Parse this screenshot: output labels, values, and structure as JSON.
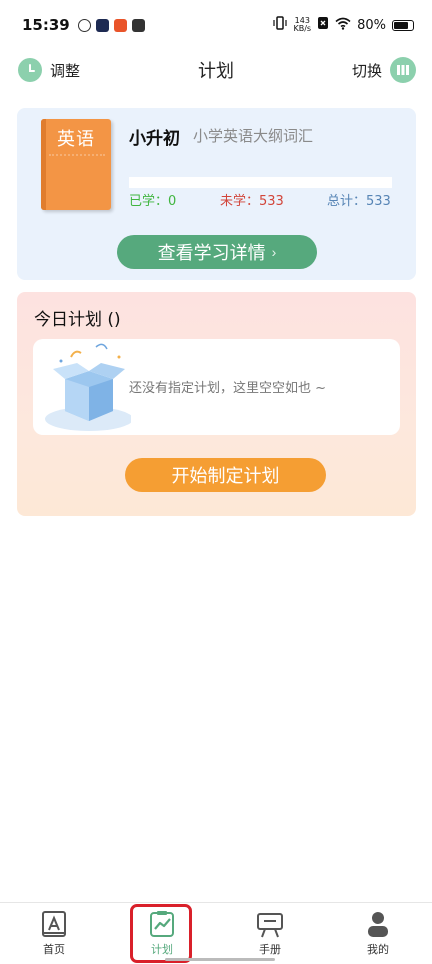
{
  "status_bar": {
    "time": "15:39",
    "net_speed_value": "143",
    "net_speed_unit": "KB/s",
    "battery": "80%"
  },
  "header": {
    "left_label": "调整",
    "title": "计划",
    "right_label": "切换"
  },
  "book": {
    "cover_text": "英语",
    "level": "小升初",
    "name": "小学英语大纲词汇",
    "learned": "已学：0",
    "unlearned": "未学：533",
    "total": "总计：533",
    "progress_fraction": 0,
    "details_button": "查看学习详情"
  },
  "plan": {
    "title": "今日计划 ()",
    "empty_text": "还没有指定计划，这里空空如也 ~",
    "start_button": "开始制定计划"
  },
  "nav": [
    {
      "label": "首页",
      "icon": "home-icon",
      "active": false
    },
    {
      "label": "计划",
      "icon": "plan-chart-icon",
      "active": true
    },
    {
      "label": "手册",
      "icon": "easel-icon",
      "active": false
    },
    {
      "label": "我的",
      "icon": "profile-icon",
      "active": false
    }
  ],
  "colors": {
    "accent_green": "#56a97d",
    "accent_orange": "#f59e33",
    "learned": "#40b53f",
    "unlearned": "#d2453a",
    "total": "#5684b5",
    "highlight_outline": "#d9202a"
  }
}
